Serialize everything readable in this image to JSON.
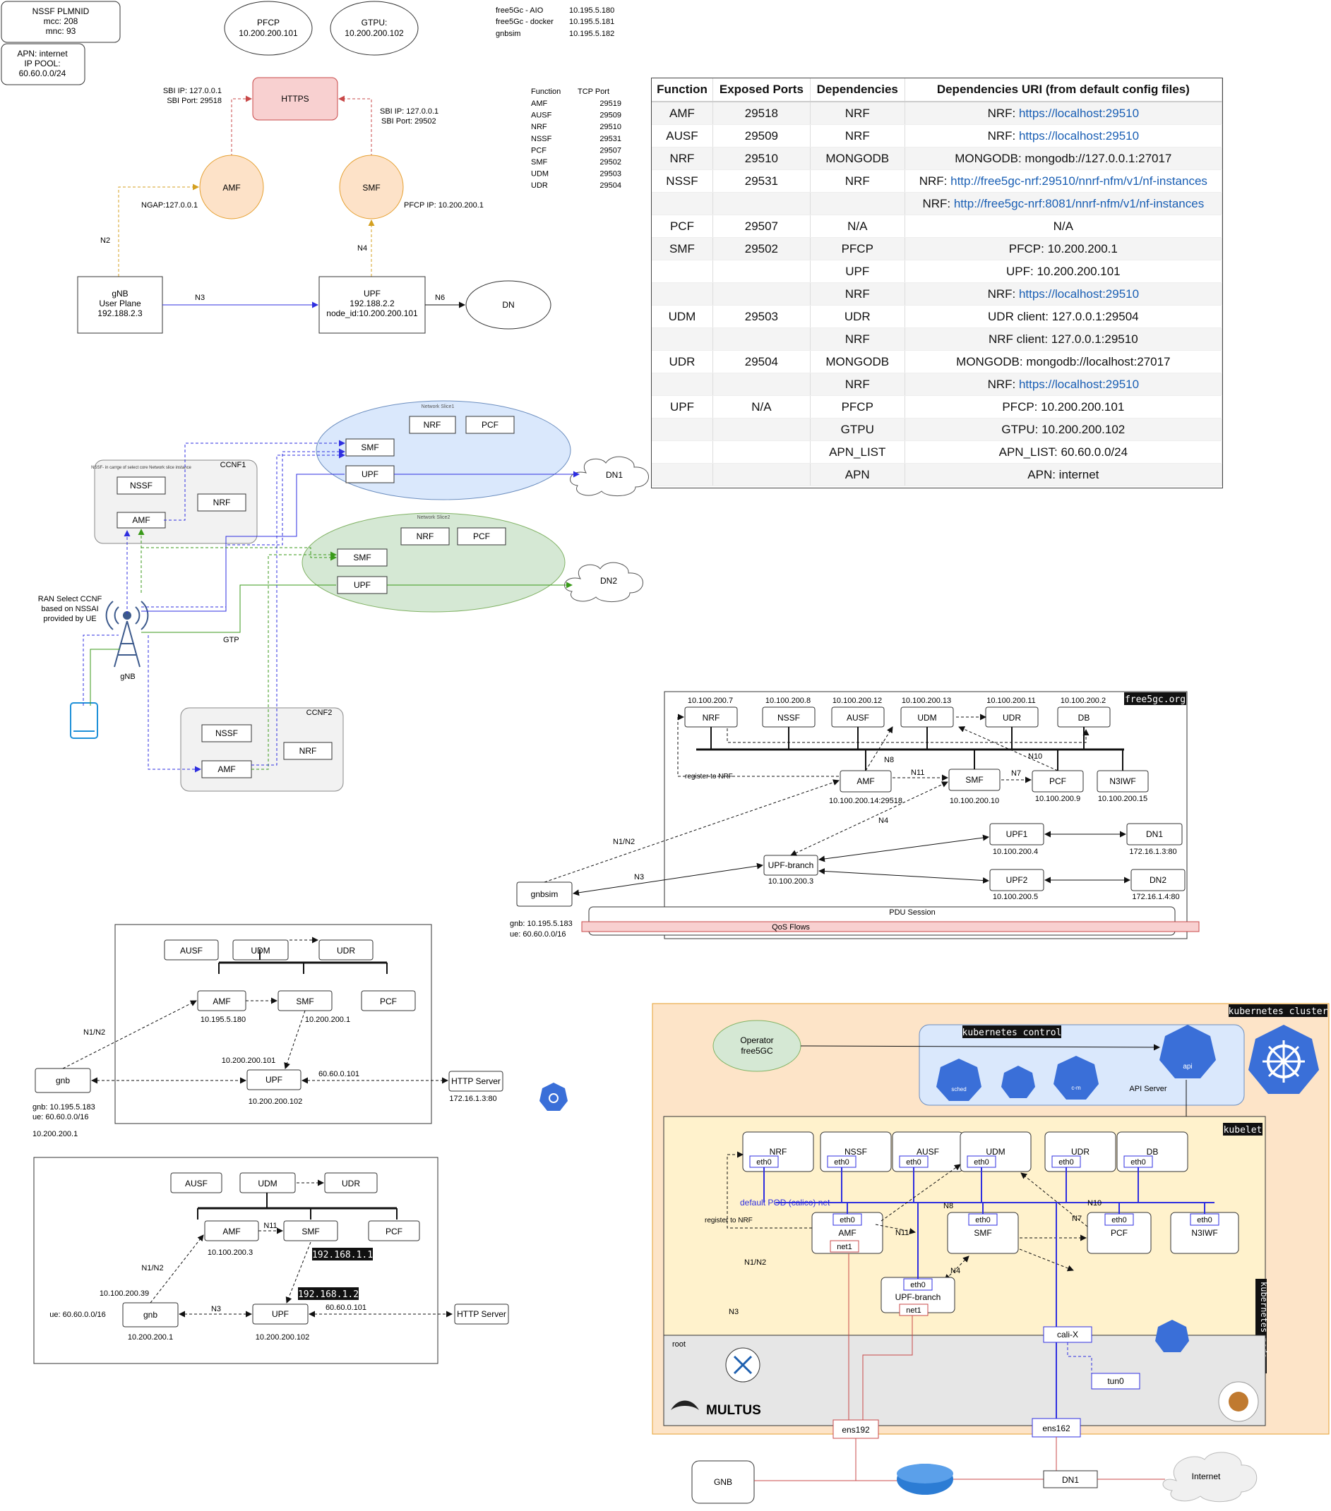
{
  "sec1": {
    "nssf_plmnid": [
      "NSSF PLMNID",
      "mcc: 208",
      "mnc: 93"
    ],
    "apn_box": [
      "APN: internet",
      "IP POOL:",
      "60.60.0.0/24"
    ],
    "pfcp_ellipse": [
      "PFCP",
      "10.200.200.101"
    ],
    "gtpu_ellipse": [
      "GTPU:",
      "10.200.200.102"
    ],
    "hosts": [
      {
        "name": "free5Gc - AIO",
        "ip": "10.195.5.180"
      },
      {
        "name": "free5Gc - docker",
        "ip": "10.195.5.181"
      },
      {
        "name": "gnbsim",
        "ip": "10.195.5.182"
      }
    ],
    "https": "HTTPS",
    "amf_sbi": [
      "SBI IP: 127.0.0.1",
      "SBI Port: 29518"
    ],
    "smf_sbi": [
      "SBI IP: 127.0.0.1",
      "SBI Port: 29502"
    ],
    "amf": "AMF",
    "smf": "SMF",
    "ngap": "NGAP:127.0.0.1",
    "pfcp_ip": "PFCP IP: 10.200.200.1",
    "n2": "N2",
    "n4": "N4",
    "n3": "N3",
    "n6": "N6",
    "gnb": [
      "gNB",
      "User Plane",
      "192.188.2.3"
    ],
    "upf": [
      "UPF",
      "192.188.2.2",
      "node_id:10.200.200.101"
    ],
    "dn": "DN",
    "port_header": {
      "function": "Function",
      "port": "TCP Port"
    },
    "ports": [
      {
        "f": "AMF",
        "p": "29519"
      },
      {
        "f": "AUSF",
        "p": "29509"
      },
      {
        "f": "NRF",
        "p": "29510"
      },
      {
        "f": "NSSF",
        "p": "29531"
      },
      {
        "f": "PCF",
        "p": "29507"
      },
      {
        "f": "SMF",
        "p": "29502"
      },
      {
        "f": "UDM",
        "p": "29503"
      },
      {
        "f": "UDR",
        "p": "29504"
      }
    ]
  },
  "table": {
    "headers": [
      "Function",
      "Exposed Ports",
      "Dependencies",
      "Dependencies URI (from default config files)"
    ],
    "rows": [
      {
        "fn": "AMF",
        "port": "29518",
        "dep": "NRF",
        "uri_label": "NRF: ",
        "uri_link": "https://localhost:29510"
      },
      {
        "fn": "AUSF",
        "port": "29509",
        "dep": "NRF",
        "uri_label": "NRF: ",
        "uri_link": "https://localhost:29510"
      },
      {
        "fn": "NRF",
        "port": "29510",
        "dep": "MONGODB",
        "uri_label": "MONGODB: mongodb://127.0.0.1:27017",
        "uri_link": ""
      },
      {
        "fn": "NSSF",
        "port": "29531",
        "dep": "NRF",
        "uri_label": "NRF: ",
        "uri_link": "http://free5gc-nrf:29510/nnrf-nfm/v1/nf-instances"
      },
      {
        "fn": "",
        "port": "",
        "dep": "",
        "uri_label": "NRF: ",
        "uri_link": "http://free5gc-nrf:8081/nnrf-nfm/v1/nf-instances"
      },
      {
        "fn": "PCF",
        "port": "29507",
        "dep": "N/A",
        "uri_label": "N/A",
        "uri_link": ""
      },
      {
        "fn": "SMF",
        "port": "29502",
        "dep": "PFCP",
        "uri_label": "PFCP: 10.200.200.1",
        "uri_link": ""
      },
      {
        "fn": "",
        "port": "",
        "dep": "UPF",
        "uri_label": "UPF: 10.200.200.101",
        "uri_link": ""
      },
      {
        "fn": "",
        "port": "",
        "dep": "NRF",
        "uri_label": "NRF: ",
        "uri_link": "https://localhost:29510"
      },
      {
        "fn": "UDM",
        "port": "29503",
        "dep": "UDR",
        "uri_label": "UDR client: 127.0.0.1:29504",
        "uri_link": ""
      },
      {
        "fn": "",
        "port": "",
        "dep": "NRF",
        "uri_label": "NRF client: 127.0.0.1:29510",
        "uri_link": ""
      },
      {
        "fn": "UDR",
        "port": "29504",
        "dep": "MONGODB",
        "uri_label": "MONGODB: mongodb://localhost:27017",
        "uri_link": ""
      },
      {
        "fn": "",
        "port": "",
        "dep": "NRF",
        "uri_label": "NRF: ",
        "uri_link": "https://localhost:29510"
      },
      {
        "fn": "UPF",
        "port": "N/A",
        "dep": "PFCP",
        "uri_label": "PFCP: 10.200.200.101",
        "uri_link": ""
      },
      {
        "fn": "",
        "port": "",
        "dep": "GTPU",
        "uri_label": "GTPU: 10.200.200.102",
        "uri_link": ""
      },
      {
        "fn": "",
        "port": "",
        "dep": "APN_LIST",
        "uri_label": "APN_LIST: 60.60.0.0/24",
        "uri_link": ""
      },
      {
        "fn": "",
        "port": "",
        "dep": "APN",
        "uri_label": "APN: internet",
        "uri_link": ""
      }
    ]
  },
  "slices": {
    "slice1": "Network Slice1",
    "slice2": "Network Slice2",
    "nrf": "NRF",
    "pcf": "PCF",
    "smf": "SMF",
    "upf": "UPF",
    "dn1": "DN1",
    "dn2": "DN2",
    "ccnf1": "CCNF1",
    "ccnf2": "CCNF2",
    "nssf_note": "NSSF- in carrge of select core Network slice instance",
    "nssf": "NSSF",
    "amf": "AMF",
    "ran_select": [
      "RAN Select CCNF",
      "based on NSSAI",
      "provided by UE"
    ],
    "gtp": "GTP",
    "gnb": "gNB"
  },
  "topo": {
    "badge": "free5gc.org",
    "top_ips": [
      "10.100.200.7",
      "10.100.200.8",
      "10.100.200.12",
      "10.100.200.13",
      "10.100.200.11",
      "10.100.200.2"
    ],
    "top_nfs": [
      "NRF",
      "NSSF",
      "AUSF",
      "UDM",
      "UDR",
      "DB"
    ],
    "amf": "AMF",
    "amf_ip": "10.100.200.14:29518",
    "smf": "SMF",
    "smf_ip": "10.100.200.10",
    "pcf": "PCF",
    "pcf_ip": "10.100.200.9",
    "n3iwf": "N3IWF",
    "n3iwf_ip": "10.100.200.15",
    "upf1": "UPF1",
    "upf1_ip": "10.100.200.4",
    "upf2": "UPF2",
    "upf2_ip": "10.100.200.5",
    "dn1": "DN1",
    "dn1_ip": "172.16.1.3:80",
    "dn2": "DN2",
    "dn2_ip": "172.16.1.4:80",
    "upf_branch": "UPF-branch",
    "upf_branch_ip": "10.100.200.3",
    "gnbsim": "gnbsim",
    "gnbsim_lines": [
      "gnb: 10.195.5.183",
      "ue: 60.60.0.0/16"
    ],
    "register": "register to NRF",
    "n8": "N8",
    "n11": "N11",
    "n7": "N7",
    "n10": "N10",
    "n4": "N4",
    "n1n2": "N1/N2",
    "n3": "N3",
    "pdu": "PDU Session",
    "qos": "QoS Flows"
  },
  "lab1": {
    "ausf": "AUSF",
    "udm": "UDM",
    "udr": "UDR",
    "amf": "AMF",
    "smf": "SMF",
    "pcf": "PCF",
    "upf": "UPF",
    "amf_ip": "10.195.5.180",
    "smf_ip": "10.200.200.1",
    "upf_top": "10.200.200.101",
    "upf_ip": "10.200.200.102",
    "gnb": "gnb",
    "http": "HTTP Server",
    "http_ip": "172.16.1.3:80",
    "link_ip": "60.60.0.101",
    "n1n2": "N1/N2",
    "gnb_lines": [
      "gnb: 10.195.5.183",
      "ue: 60.60.0.0/16",
      "10.200.200.1"
    ]
  },
  "lab2": {
    "ausf": "AUSF",
    "udm": "UDM",
    "udr": "UDR",
    "amf": "AMF",
    "smf": "SMF",
    "pcf": "PCF",
    "upf": "UPF",
    "amf_ip": "10.100.200.3",
    "n11": "N11",
    "tag1": "192.168.1.1",
    "tag2": "192.168.1.2",
    "n1n2": "N1/N2",
    "gnb_ip_top": "10.100.200.39",
    "ue": "ue: 60.60.0.0/16",
    "gnb": "gnb",
    "n3": "N3",
    "link_ip": "60.60.0.101",
    "http": "HTTP Server",
    "gnb_ip": "10.200.200.1",
    "upf_ip": "10.200.200.102"
  },
  "k8s": {
    "cluster_badge": "kubernetes cluster",
    "control_badge": "kubernetes control",
    "kubelet_badge": "kubelet",
    "node_badge": "kubernetes node",
    "operator": [
      "Operator",
      "free5GC"
    ],
    "api": "api",
    "api_server": "API Server",
    "sched": "sched",
    "cm": "c-m",
    "nfs_top": [
      "NRF",
      "NSSF",
      "AUSF",
      "UDM",
      "UDR",
      "DB"
    ],
    "eth0": "eth0",
    "net1": "net1",
    "default_net": "default POD (calico) net",
    "register": "register to NRF",
    "amf": "AMF",
    "smf": "SMF",
    "pcf": "PCF",
    "n3iwf": "N3IWF",
    "upf_branch": "UPF-branch",
    "n8": "N8",
    "n10": "N10",
    "n7": "N7",
    "n11": "N11",
    "n4": "N4",
    "n1n2": "N1/N2",
    "n3": "N3",
    "root": "root",
    "calix": "cali-X",
    "tun0": "tun0",
    "ens192": "ens192",
    "ens162": "ens162",
    "multus": "MULTUS",
    "gnb": "GNB",
    "dn1": "DN1",
    "internet": "Internet"
  }
}
